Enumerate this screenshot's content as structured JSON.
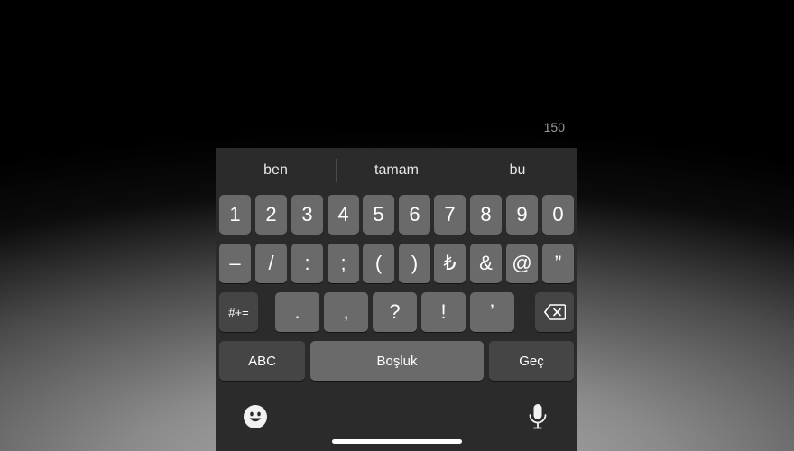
{
  "char_counter": "150",
  "suggestions": [
    "ben",
    "tamam",
    "bu"
  ],
  "row1": [
    "1",
    "2",
    "3",
    "4",
    "5",
    "6",
    "7",
    "8",
    "9",
    "0"
  ],
  "row2": [
    "–",
    "/",
    ":",
    ";",
    "(",
    ")",
    "₺",
    "&",
    "@",
    "”"
  ],
  "row3": {
    "toggle": "#+=",
    "keys": [
      ".",
      ",",
      "?",
      "!",
      "’"
    ]
  },
  "row4": {
    "abc": "ABC",
    "space": "Boşluk",
    "return": "Geç"
  },
  "icons": {
    "backspace": "backspace-icon",
    "emoji": "emoji-icon",
    "microphone": "microphone-icon"
  }
}
